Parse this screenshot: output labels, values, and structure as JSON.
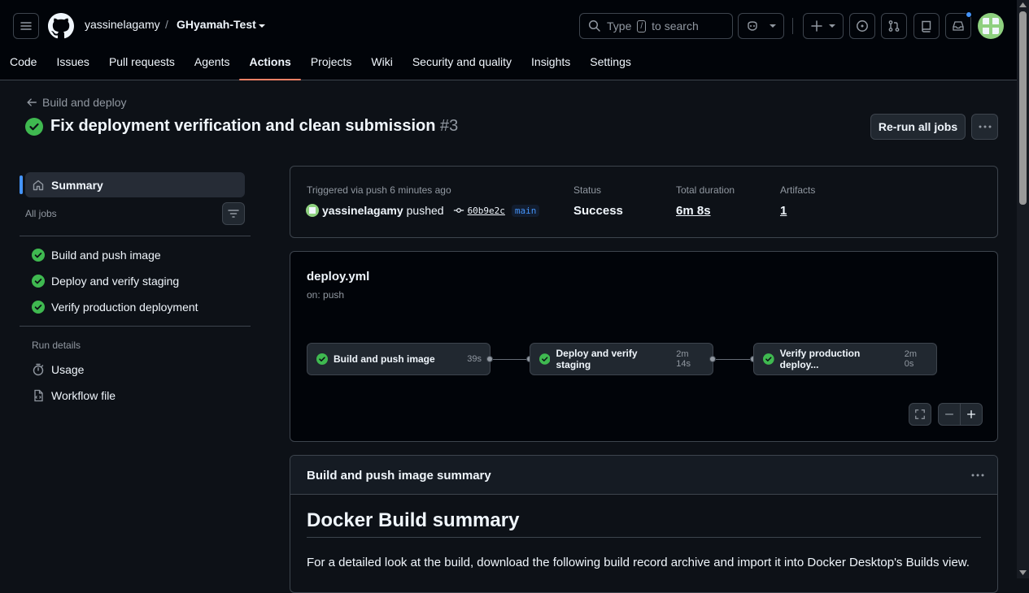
{
  "header": {
    "owner": "yassinelagamy",
    "separator": "/",
    "repo": "GHyamah-Test",
    "search": {
      "prefix": "Type",
      "key": "/",
      "suffix": "to search"
    }
  },
  "nav": [
    "Code",
    "Issues",
    "Pull requests",
    "Agents",
    "Actions",
    "Projects",
    "Wiki",
    "Security and quality",
    "Insights",
    "Settings"
  ],
  "nav_active": "Actions",
  "run": {
    "back_label": "Build and deploy",
    "title": "Fix deployment verification and clean submission",
    "number": "#3",
    "rerun_label": "Re-run all jobs"
  },
  "sidebar": {
    "summary_label": "Summary",
    "all_jobs_label": "All jobs",
    "jobs": [
      "Build and push image",
      "Deploy and verify staging",
      "Verify production deployment"
    ],
    "run_details_label": "Run details",
    "usage_label": "Usage",
    "workflow_file_label": "Workflow file"
  },
  "meta": {
    "trigger_label": "Triggered via push 6 minutes ago",
    "actor": "yassinelagamy",
    "action": "pushed",
    "commit": "60b9e2c",
    "branch": "main",
    "status_label": "Status",
    "status_value": "Success",
    "duration_label": "Total duration",
    "duration_value": "6m 8s",
    "artifacts_label": "Artifacts",
    "artifacts_value": "1"
  },
  "graph": {
    "file": "deploy.yml",
    "trigger": "on: push",
    "jobs": [
      {
        "name": "Build and push image",
        "duration": "39s"
      },
      {
        "name": "Deploy and verify staging",
        "duration": "2m 14s"
      },
      {
        "name": "Verify production deploy...",
        "duration": "2m 0s"
      }
    ]
  },
  "summary": {
    "header": "Build and push image summary",
    "h1": "Docker Build summary",
    "paragraph": "For a detailed look at the build, download the following build record archive and import it into Docker Desktop's Builds view."
  },
  "colors": {
    "success": "#3fb950",
    "accent": "#4493f8",
    "underline": "#f78166",
    "bg": "#0d1117"
  },
  "icons": [
    "hamburger-icon",
    "github-mark-icon",
    "caret-down-icon",
    "search-icon",
    "copilot-icon",
    "plus-icon",
    "issue-icon",
    "pull-request-icon",
    "repo-icon",
    "inbox-icon",
    "arrow-left-icon",
    "check-circle-icon",
    "kebab-icon",
    "home-icon",
    "filter-icon",
    "stopwatch-icon",
    "file-code-icon",
    "commit-icon",
    "fullscreen-icon",
    "minus-icon"
  ]
}
